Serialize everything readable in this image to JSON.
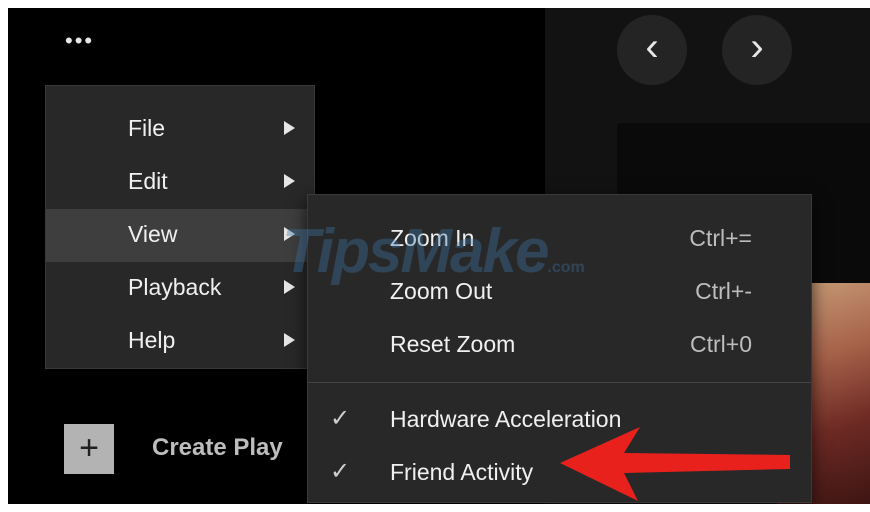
{
  "toolbar": {
    "more_icon": "•••"
  },
  "nav": {
    "back_icon": "‹",
    "forward_icon": "›"
  },
  "sidebar": {
    "create_icon": "+",
    "create_label": "Create Play"
  },
  "menu": {
    "items": [
      {
        "label": "File",
        "has_submenu": true,
        "active": false
      },
      {
        "label": "Edit",
        "has_submenu": true,
        "active": false
      },
      {
        "label": "View",
        "has_submenu": true,
        "active": true
      },
      {
        "label": "Playback",
        "has_submenu": true,
        "active": false
      },
      {
        "label": "Help",
        "has_submenu": true,
        "active": false
      }
    ]
  },
  "submenu": {
    "items": [
      {
        "label": "Zoom In",
        "shortcut": "Ctrl+="
      },
      {
        "label": "Zoom Out",
        "shortcut": "Ctrl+-"
      },
      {
        "label": "Reset Zoom",
        "shortcut": "Ctrl+0"
      }
    ],
    "toggles": [
      {
        "label": "Hardware Acceleration",
        "checked": true,
        "check_icon": "✓"
      },
      {
        "label": "Friend Activity",
        "checked": true,
        "check_icon": "✓"
      }
    ]
  },
  "watermark": {
    "text": "TipsMake",
    "suffix": ".com"
  },
  "colors": {
    "arrow": "#e8211c",
    "menu_bg": "#282828",
    "active_bg": "#3e3e3e"
  }
}
